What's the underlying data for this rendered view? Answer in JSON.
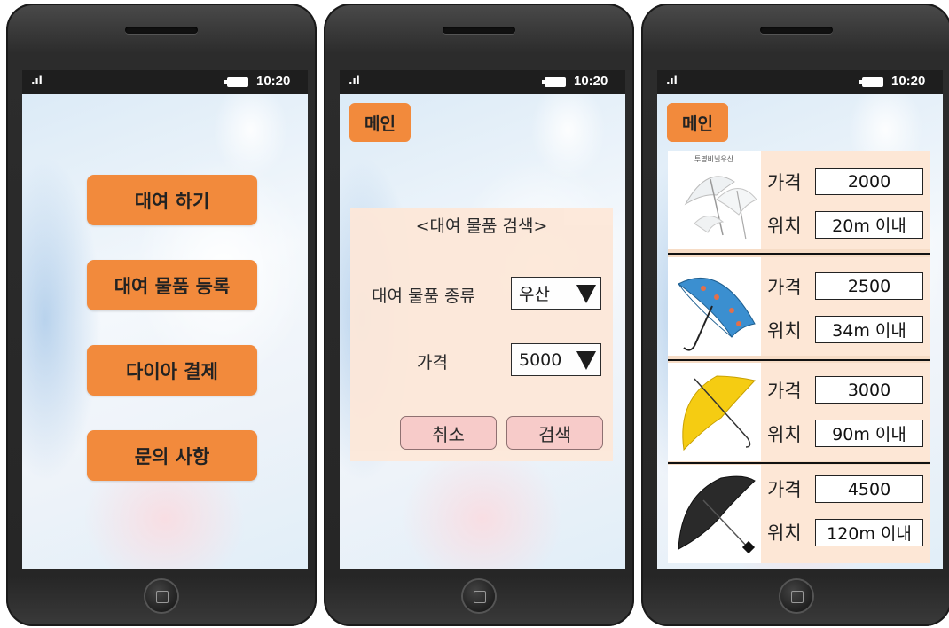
{
  "status": {
    "time": "10:20",
    "signal": ".ıl"
  },
  "phone1": {
    "buttons": [
      "대여 하기",
      "대여 물품 등록",
      "다이아 결제",
      "문의 사항"
    ]
  },
  "phone2": {
    "main_button": "메인",
    "search_title": "<대여 물품 검색>",
    "type_label": "대여 물품 종류",
    "type_value": "우산",
    "price_label": "가격",
    "price_value": "5000",
    "cancel": "취소",
    "search": "검색"
  },
  "phone3": {
    "main_button": "메인",
    "price_label": "가격",
    "location_label": "위치",
    "items": [
      {
        "image_caption": "투명비닐우산",
        "price": "2000",
        "location": "20m 이내",
        "icon": "clear-umbrella-icon",
        "color": "#e8eef2"
      },
      {
        "image_caption": "",
        "price": "2500",
        "location": "34m 이내",
        "icon": "blue-umbrella-icon",
        "color": "#3b8fd0"
      },
      {
        "image_caption": "",
        "price": "3000",
        "location": "90m 이내",
        "icon": "yellow-umbrella-icon",
        "color": "#f5cc12"
      },
      {
        "image_caption": "",
        "price": "4500",
        "location": "120m 이내",
        "icon": "black-umbrella-icon",
        "color": "#2a2a2a"
      }
    ]
  }
}
